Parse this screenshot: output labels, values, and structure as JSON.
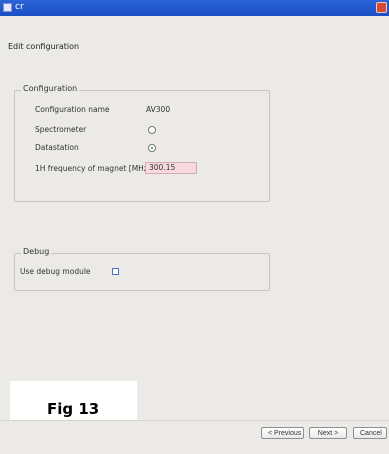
{
  "window": {
    "title": "cr"
  },
  "heading": "Edit configuration",
  "configuration": {
    "legend": "Configuration",
    "rows": [
      {
        "label": "Configuration name",
        "value": "AV300"
      },
      {
        "label": "Spectrometer",
        "value": ""
      },
      {
        "label": "Datastation",
        "value": ""
      },
      {
        "label": "1H frequency of magnet [MHz]",
        "value": "300.15"
      }
    ],
    "spectrometer_selected": false,
    "datastation_selected": true
  },
  "debug": {
    "legend": "Debug",
    "use_debug_label": "Use debug module",
    "checked": false
  },
  "figure": {
    "label": "Fig 13"
  },
  "buttons": {
    "previous": "< Previous",
    "next": "Next >",
    "cancel": "Cancel"
  },
  "colors": {
    "titlebar": "#2358d3",
    "field_bg": "#f8d9df",
    "panel_border": "#c9c6bf",
    "window_bg": "#eceae6"
  }
}
